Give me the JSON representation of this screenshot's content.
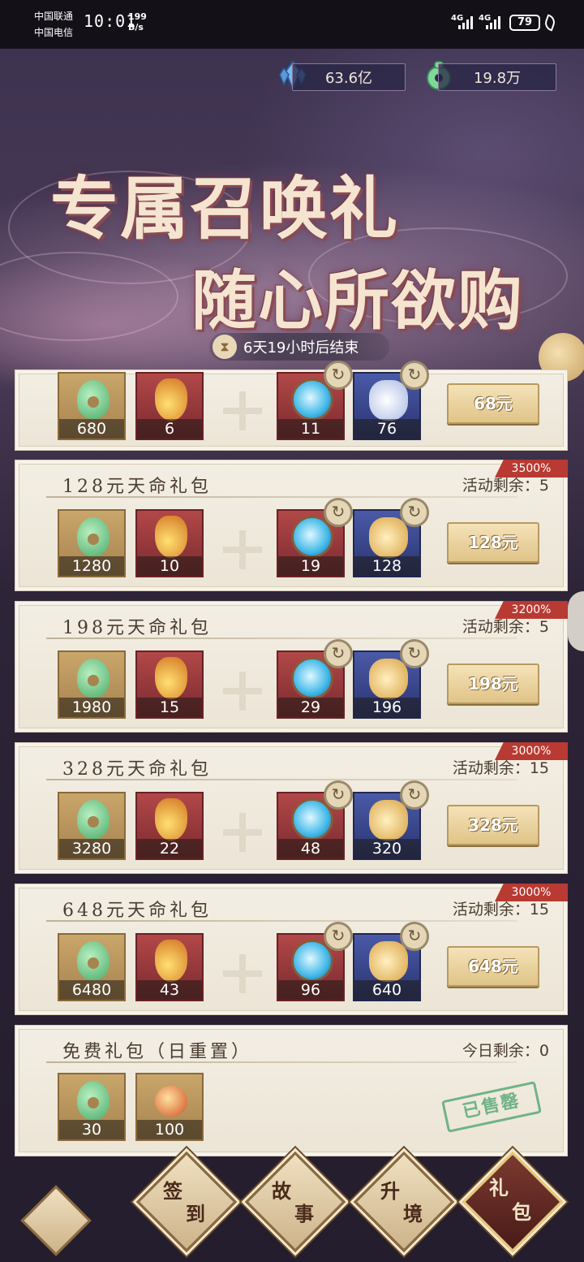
{
  "status_bar": {
    "carrier1": "中国联通",
    "carrier2": "中国电信",
    "time": "10:01",
    "speed_value": "199",
    "speed_unit": "B/s",
    "network1": "4G",
    "network2": "4G",
    "battery": "79"
  },
  "currency": {
    "crystals": "63.6亿",
    "jade": "19.8万"
  },
  "banner": {
    "line1": "专属召唤礼",
    "line2": "随心所欲购",
    "timer": "6天19小时后结束"
  },
  "packs": [
    {
      "items": [
        "680",
        "6",
        "11",
        "76"
      ],
      "price": "68元"
    },
    {
      "title": "128元天命礼包",
      "remain": "活动剩余：5",
      "badge": "3500%",
      "items": [
        "1280",
        "10",
        "19",
        "128"
      ],
      "price": "128元"
    },
    {
      "title": "198元天命礼包",
      "remain": "活动剩余：5",
      "badge": "3200%",
      "items": [
        "1980",
        "15",
        "29",
        "196"
      ],
      "price": "198元"
    },
    {
      "title": "328元天命礼包",
      "remain": "活动剩余：15",
      "badge": "3000%",
      "items": [
        "3280",
        "22",
        "48",
        "320"
      ],
      "price": "328元"
    },
    {
      "title": "648元天命礼包",
      "remain": "活动剩余：15",
      "badge": "3000%",
      "items": [
        "6480",
        "43",
        "96",
        "640"
      ],
      "price": "648元"
    }
  ],
  "free_pack": {
    "title": "免费礼包（日重置）",
    "remain": "今日剩余：0",
    "items": [
      "30",
      "100"
    ],
    "status": "已售罄"
  },
  "nav": {
    "home_icon": "cloud-swirl-icon",
    "items": [
      {
        "l1": "签",
        "l2": "到"
      },
      {
        "l1": "故",
        "l2": "事"
      },
      {
        "l1": "升",
        "l2": "境"
      },
      {
        "l1": "礼",
        "l2": "包"
      }
    ]
  }
}
